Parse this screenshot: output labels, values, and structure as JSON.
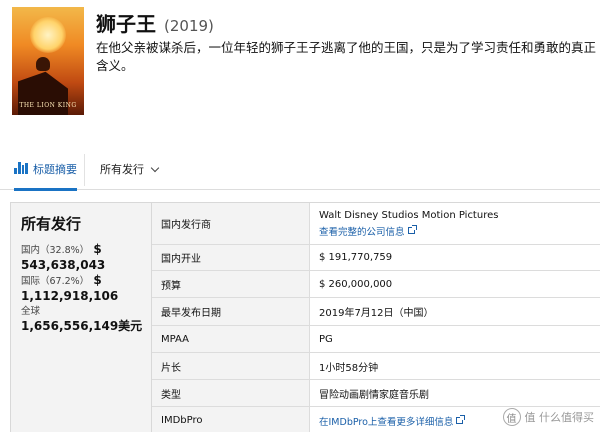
{
  "movie": {
    "title": "狮子王",
    "year": "(2019)",
    "synopsis": "在他父亲被谋杀后，一位年轻的狮子王子逃离了他的王国，只是为了学习责任和勇敢的真正含义。",
    "poster": {
      "title_text": "THE LION KING",
      "top_text": ""
    }
  },
  "tabs": {
    "summary_label": "标题摘要",
    "releases_label": "所有发行"
  },
  "summary": {
    "title": "所有发行",
    "domestic_label": "国内（32.8%）",
    "domestic_value": "$ 543,638,043",
    "international_label": "国际（67.2%）",
    "international_value": "$ 1,112,918,106",
    "worldwide_label": "全球",
    "worldwide_value": "1,656,556,149美元"
  },
  "details": [
    {
      "key": "国内发行商",
      "value": "Walt Disney Studios Motion Pictures",
      "link": "查看完整的公司信息"
    },
    {
      "key": "国内开业",
      "value": "$ 191,770,759"
    },
    {
      "key": "预算",
      "value": "$ 260,000,000"
    },
    {
      "key": "最早发布日期",
      "value": "2019年7月12日（中国）"
    },
    {
      "key": "MPAA",
      "value": "PG"
    },
    {
      "key": "片长",
      "value": "1小时58分钟"
    },
    {
      "key": "类型",
      "value": "冒险动画剧情家庭音乐剧"
    },
    {
      "key": "IMDbPro",
      "value": "",
      "link": "在IMDbPro上查看更多详细信息"
    }
  ],
  "watermark": {
    "text": "值 什么值得买"
  },
  "colors": {
    "link": "#1a5fa8",
    "accent": "#1a73c4",
    "panel_bg": "#f3f3f3"
  }
}
